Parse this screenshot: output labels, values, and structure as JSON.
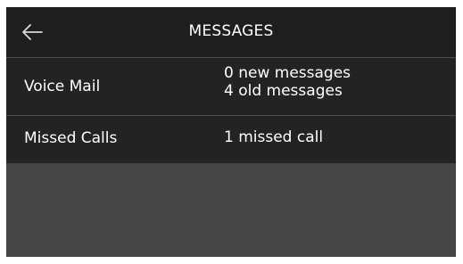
{
  "header": {
    "title": "MESSAGES",
    "back_icon": "arrow-left-icon"
  },
  "rows": [
    {
      "label": "Voice Mail",
      "values": [
        "0 new messages",
        "4 old messages"
      ]
    },
    {
      "label": "Missed Calls",
      "values": [
        "1 missed call"
      ]
    }
  ],
  "colors": {
    "header_background": "#1e1e1e",
    "row_background": "#232323",
    "empty_area_background": "#454545",
    "text": "#ffffff"
  }
}
